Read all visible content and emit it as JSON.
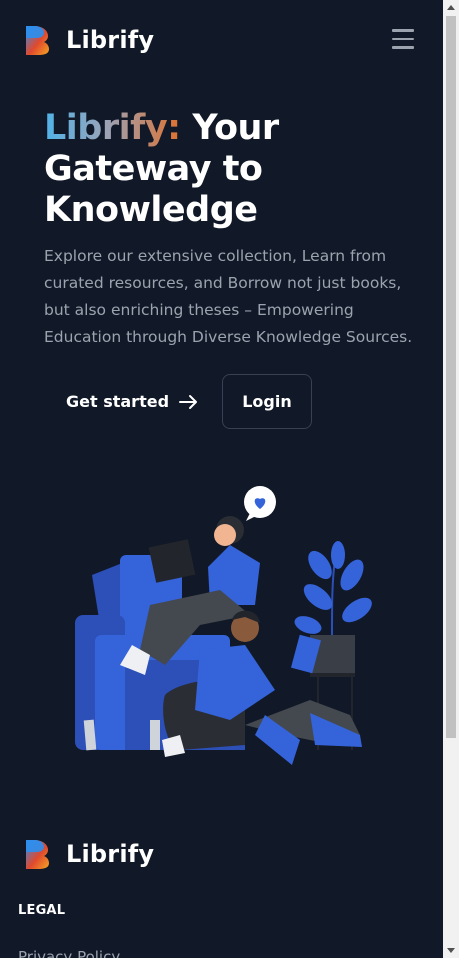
{
  "header": {
    "brand": "Librify",
    "menu_icon": "hamburger-menu-icon",
    "logo_icon": "librify-logo-icon"
  },
  "hero": {
    "title_brand": "Librify:",
    "title_rest_line1": " Your",
    "title_line2": "Gateway to",
    "title_line3": "Knowledge",
    "subtitle": "Explore our extensive collection, Learn from curated resources, and Borrow not just books, but also enriching theses – Empowering Education through Diverse Knowledge Sources.",
    "get_started_label": "Get started",
    "login_label": "Login",
    "arrow_icon": "arrow-right-icon"
  },
  "footer": {
    "brand": "Librify",
    "legal_heading": "LEGAL",
    "privacy_link": "Privacy Policy"
  },
  "colors": {
    "background": "#111827",
    "muted_text": "#9ca3af",
    "accent_blue": "#3b6fe8",
    "brand_gradient_start": "#4fb3e8",
    "brand_gradient_end": "#e0712e"
  }
}
